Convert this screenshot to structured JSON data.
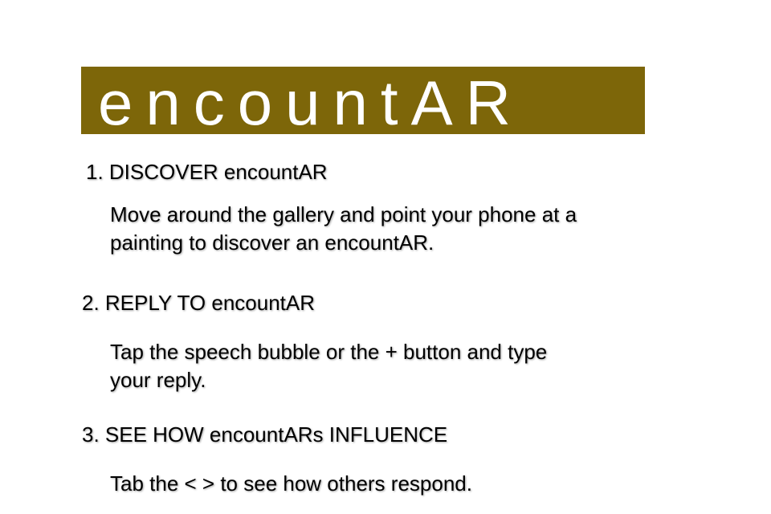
{
  "title": "encountAR",
  "colors": {
    "banner_background": "#7d6609",
    "banner_text": "#ffffff",
    "body_text": "#000000"
  },
  "steps": [
    {
      "heading": "1. DISCOVER encountAR",
      "body_lines": [
        "Move around the gallery and point your phone at a",
        "painting to discover an encountAR."
      ]
    },
    {
      "heading": "2. REPLY TO encountAR",
      "body_lines": [
        "Tap the speech bubble or the + button and type",
        "your reply."
      ]
    },
    {
      "heading": "3. SEE HOW encountARs INFLUENCE",
      "body_lines": [
        "Tab the <  > to see how others respond."
      ]
    }
  ]
}
